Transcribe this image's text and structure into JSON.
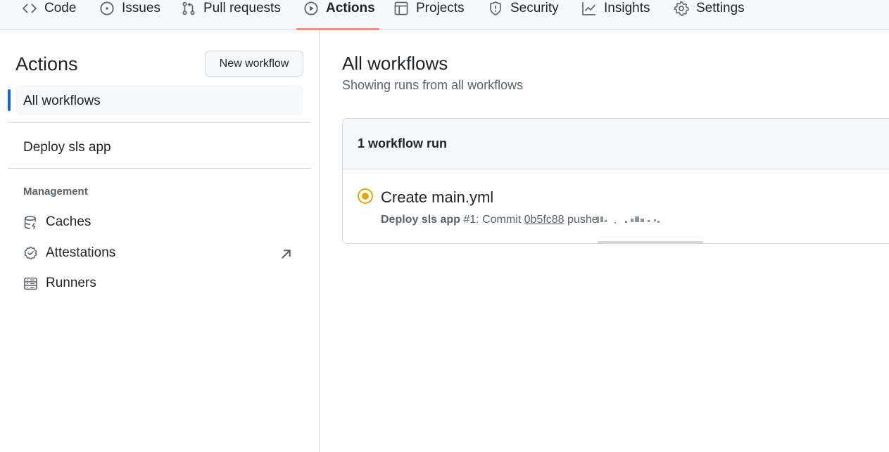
{
  "nav": {
    "tabs": [
      {
        "label": "Code",
        "icon": "code-icon"
      },
      {
        "label": "Issues",
        "icon": "issue-opened-icon"
      },
      {
        "label": "Pull requests",
        "icon": "git-pull-request-icon"
      },
      {
        "label": "Actions",
        "icon": "play-icon",
        "selected": true
      },
      {
        "label": "Projects",
        "icon": "table-icon"
      },
      {
        "label": "Security",
        "icon": "shield-icon"
      },
      {
        "label": "Insights",
        "icon": "graph-icon"
      },
      {
        "label": "Settings",
        "icon": "gear-icon"
      }
    ],
    "accent_color": "#fd8c73"
  },
  "sidebar": {
    "title": "Actions",
    "new_workflow_label": "New workflow",
    "all_workflows_label": "All workflows",
    "workflows": [
      {
        "label": "Deploy sls app"
      }
    ],
    "management_heading": "Management",
    "management_items": [
      {
        "label": "Caches",
        "icon": "database-icon"
      },
      {
        "label": "Attestations",
        "icon": "verified-icon",
        "external": true
      },
      {
        "label": "Runners",
        "icon": "server-icon"
      }
    ],
    "active_color": "#0969da"
  },
  "main": {
    "title": "All workflows",
    "subtitle": "Showing runs from all workflows",
    "runs_count_label": "1 workflow run",
    "runs": [
      {
        "title": "Create main.yml",
        "status": "in-progress",
        "status_color": "#dbab0a",
        "workflow": "Deploy sls app",
        "run_number": "#1: Commit",
        "sha": "0b5fc88",
        "pushed_text": "pushe"
      }
    ]
  }
}
